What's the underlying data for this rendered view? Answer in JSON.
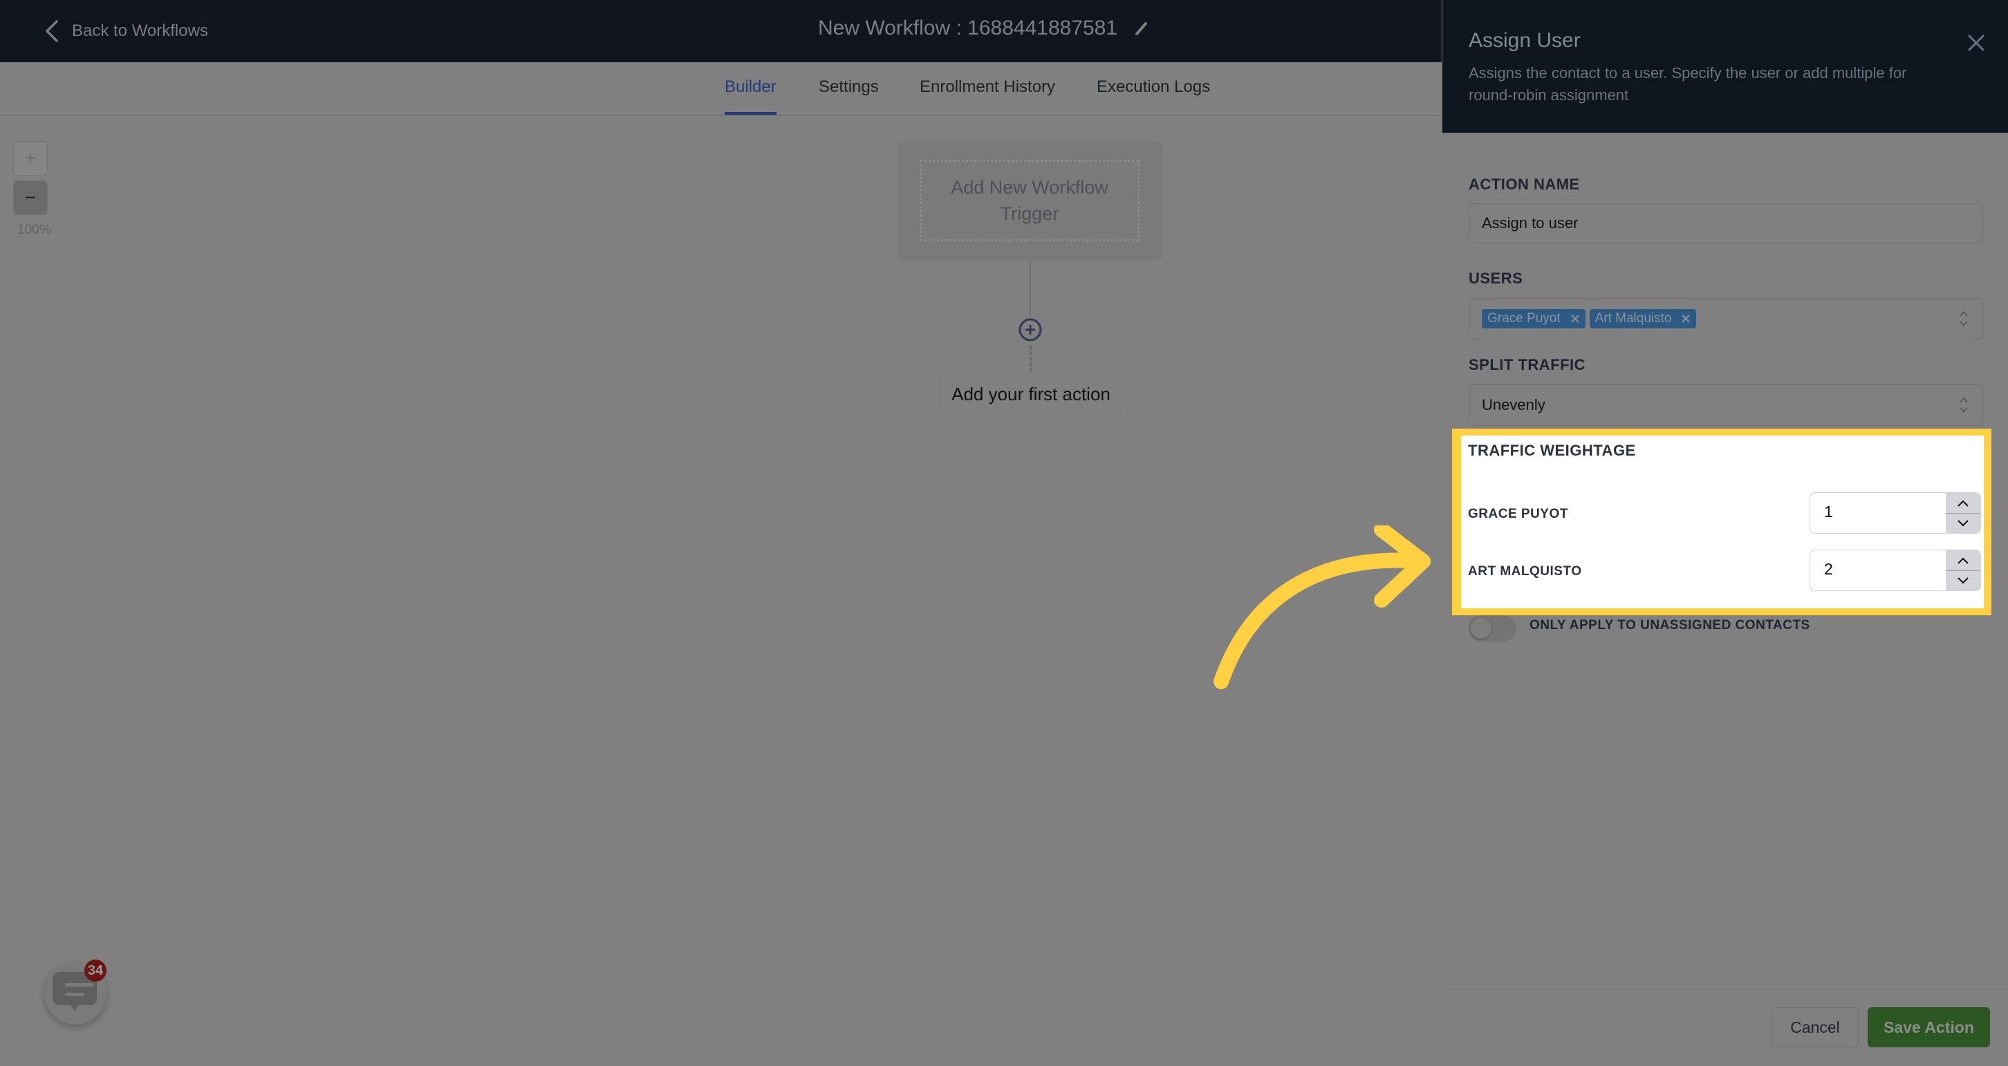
{
  "topbar": {
    "back_label": "Back to Workflows",
    "workflow_title": "New Workflow : 1688441887581"
  },
  "tabs": [
    {
      "label": "Builder",
      "active": true
    },
    {
      "label": "Settings",
      "active": false
    },
    {
      "label": "Enrollment History",
      "active": false
    },
    {
      "label": "Execution Logs",
      "active": false
    }
  ],
  "canvas": {
    "zoom_in_label": "+",
    "zoom_out_label": "−",
    "zoom_level": "100%",
    "trigger_label": "Add New Workflow Trigger",
    "first_action_label": "Add your first action",
    "chat_badge_count": "34"
  },
  "panel": {
    "title": "Assign User",
    "description": "Assigns the contact to a user. Specify the user or add multiple for round-robin assignment",
    "action_name": {
      "label": "ACTION NAME",
      "value": "Assign to user"
    },
    "users": {
      "label": "USERS",
      "selected": [
        "Grace Puyot",
        "Art Malquisto"
      ]
    },
    "split_traffic": {
      "label": "SPLIT TRAFFIC",
      "value": "Unevenly"
    },
    "traffic_weightage": {
      "title": "TRAFFIC WEIGHTAGE",
      "rows": [
        {
          "label": "GRACE PUYOT",
          "value": "1"
        },
        {
          "label": "ART MALQUISTO",
          "value": "2"
        }
      ]
    },
    "toggle": {
      "label": "ONLY APPLY TO UNASSIGNED CONTACTS",
      "on": false
    },
    "cancel_label": "Cancel",
    "save_label": "Save Action"
  },
  "colors": {
    "topbar_bg": "#10151e",
    "active_tab": "#23397a",
    "highlight": "#ffd042",
    "save_button": "#2c5723",
    "chip_bg": "#2c5a85",
    "badge": "#6a1414"
  }
}
